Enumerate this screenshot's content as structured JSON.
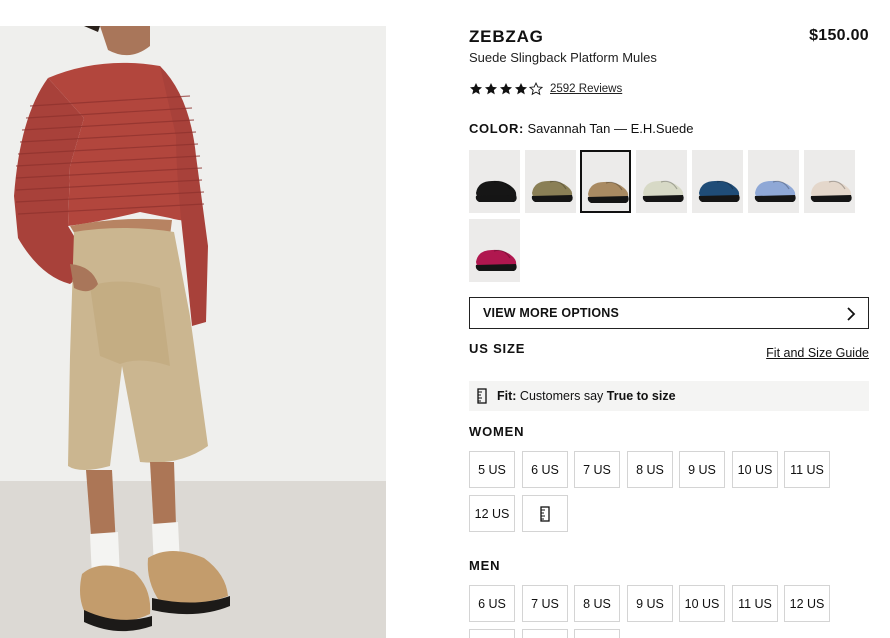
{
  "product": {
    "brand": "ZEBZAG",
    "price": "$150.00",
    "name": "Suede Slingback Platform Mules",
    "rating_stars": 4,
    "reviews_label": "2592 Reviews"
  },
  "color": {
    "label": "COLOR:",
    "value": "Savannah Tan — E.H.Suede",
    "swatches": [
      {
        "name": "black",
        "color": "#161616"
      },
      {
        "name": "olive",
        "color": "#8a7f56"
      },
      {
        "name": "tan",
        "color": "#a98a62",
        "selected": true
      },
      {
        "name": "sage",
        "color": "#d7d9c6"
      },
      {
        "name": "blue",
        "color": "#1f4c77"
      },
      {
        "name": "light-blue",
        "color": "#8fa8d6"
      },
      {
        "name": "cream",
        "color": "#e4d7cb"
      },
      {
        "name": "magenta",
        "color": "#b0174f"
      }
    ]
  },
  "view_more_label": "VIEW MORE OPTIONS",
  "size": {
    "title": "US SIZE",
    "guide_label": "Fit and Size Guide",
    "fit_label": "Fit:",
    "fit_text": "Customers say",
    "fit_value": "True to size"
  },
  "women": {
    "title": "WOMEN",
    "sizes": [
      "5 US",
      "6 US",
      "7 US",
      "8 US",
      "9 US",
      "10 US",
      "11 US",
      "12 US"
    ]
  },
  "men": {
    "title": "MEN",
    "sizes": [
      "6 US",
      "7 US",
      "8 US",
      "9 US",
      "10 US",
      "11 US",
      "12 US"
    ]
  }
}
